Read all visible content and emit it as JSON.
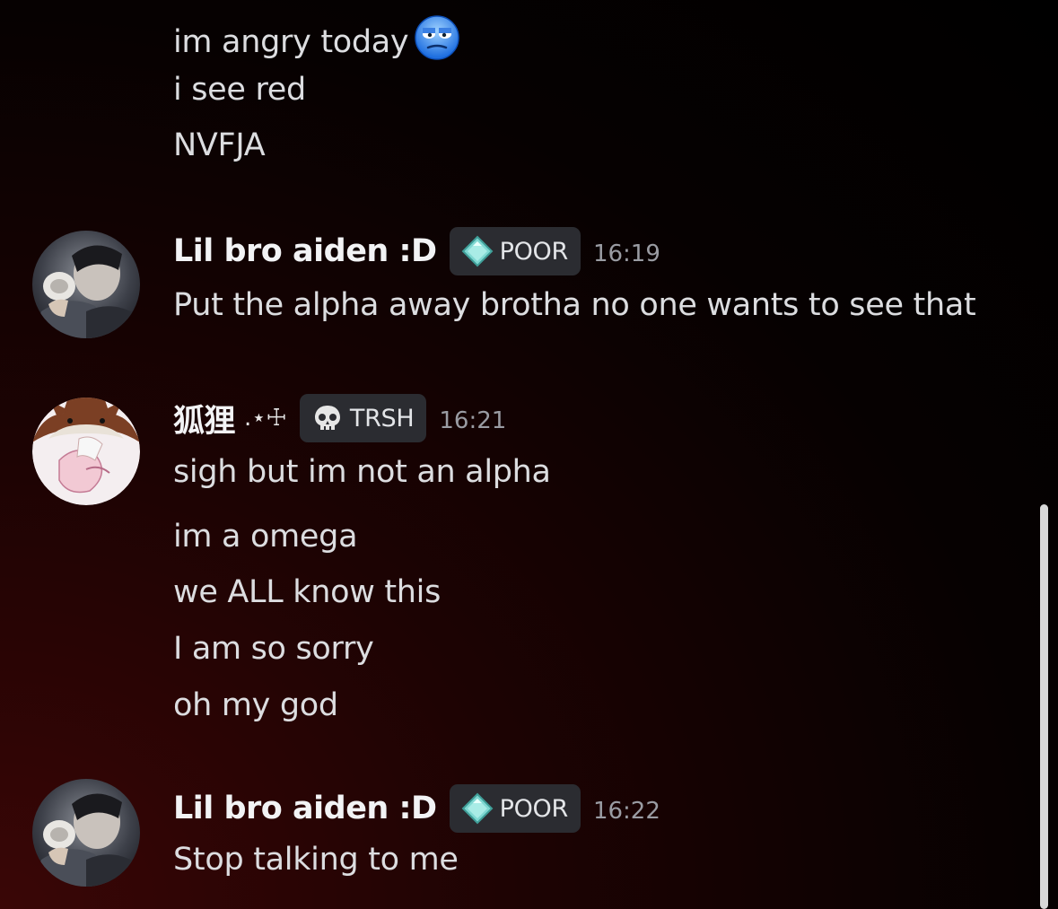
{
  "messages": [
    {
      "continuation_lines": [
        "im angry today",
        "i see red",
        "NVFJA"
      ],
      "emoji": "weary-blue-face-emoji"
    },
    {
      "username": "Lil bro aiden :D",
      "avatar": "user-photo-avatar",
      "role": {
        "icon": "diamond-icon",
        "label": "POOR"
      },
      "timestamp": "16:19",
      "lines": [
        "Put the alpha away brotha no one wants to see that"
      ]
    },
    {
      "username": "狐狸",
      "username_decoration": ".⋆☩",
      "avatar": "fox-anime-avatar",
      "role": {
        "icon": "skull-icon",
        "label": "TRSH"
      },
      "timestamp": "16:21",
      "lines": [
        "sigh but im not an alpha",
        "im a omega",
        "we ALL know this",
        "I am so sorry",
        "oh my god"
      ]
    },
    {
      "username": "Lil bro aiden :D",
      "avatar": "user-photo-avatar",
      "role": {
        "icon": "diamond-icon",
        "label": "POOR"
      },
      "timestamp": "16:22",
      "lines": [
        "Stop talking to me"
      ]
    }
  ],
  "colors": {
    "background_accent": "#3a0606",
    "text": "#dcdde0",
    "username": "#f2f3f5",
    "timestamp": "#9a9ca3",
    "badge_bg": "#2b2c31",
    "diamond": "#7fd8d2"
  }
}
